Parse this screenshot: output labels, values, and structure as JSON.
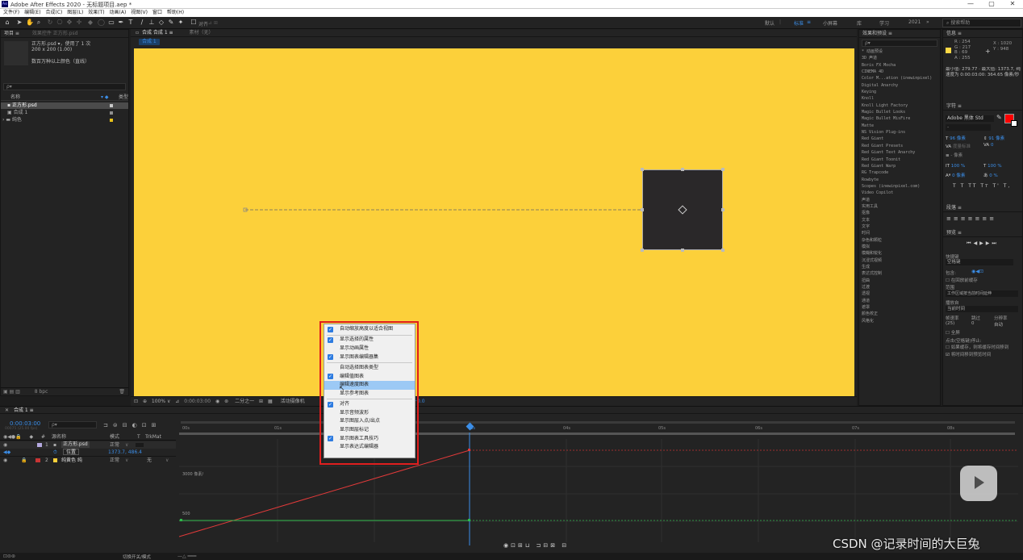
{
  "window": {
    "title": "Adobe After Effects 2020 - 无标题项目.aep *",
    "logo": "Ae",
    "min": "—",
    "max": "▢",
    "close": "✕"
  },
  "menu": [
    "文件(F)",
    "编辑(E)",
    "合成(C)",
    "图层(L)",
    "效果(T)",
    "动画(A)",
    "视图(V)",
    "窗口",
    "帮助(H)"
  ],
  "toolbar": {
    "snap_label": "对齐",
    "workspaces": [
      "默认",
      "标准",
      "小屏幕",
      "库",
      "学习",
      "2021"
    ],
    "active_workspace": "标准",
    "search_placeholder": "搜索帮助"
  },
  "project": {
    "tab": "项目 ≡",
    "effects_tab": "效果控件 正方形.psd",
    "selected_name": "正方形.psd ▾，使用了 1 次",
    "selected_size": "200 x 200 (1.00)",
    "selected_color": "数百万种以上颜色（直线）",
    "search_placeholder": "ρ▾",
    "col_name": "名称",
    "col_type": "类型",
    "items": [
      {
        "name": "正方形.psd",
        "color": "#c8c8c8"
      },
      {
        "name": "合成 1",
        "color": "#8f8f8f"
      },
      {
        "name": "纯色",
        "color": "#e8c21a"
      }
    ]
  },
  "composition": {
    "tab": "合成 合成 1 ≡",
    "footage_tab": "素材（无）",
    "breadcrumb": "合成 1",
    "zoom": "100%",
    "timecode": "0:00:03:00",
    "quality": "二分之一",
    "camera": "活动摄像机",
    "views": "1个…",
    "offset": "+0.0",
    "bit_depth": "8 bpc"
  },
  "context_menu": {
    "items": [
      {
        "label": "自动缩放高度以适合视图",
        "checked": true,
        "sep_after": true,
        "highlight": false
      },
      {
        "label": "显示选择的属性",
        "checked": true,
        "sep_after": false,
        "highlight": false
      },
      {
        "label": "显示动画属性",
        "checked": false,
        "sep_after": false,
        "highlight": false
      },
      {
        "label": "显示图表编辑器集",
        "checked": true,
        "sep_after": true,
        "highlight": false
      },
      {
        "label": "自动选择图表类型",
        "checked": false,
        "sep_after": false,
        "highlight": false
      },
      {
        "label": "编辑值图表",
        "checked": true,
        "sep_after": false,
        "highlight": false
      },
      {
        "label": "编辑速度图表",
        "checked": false,
        "sep_after": false,
        "highlight": true
      },
      {
        "label": "显示参考图表",
        "checked": false,
        "sep_after": true,
        "highlight": false
      },
      {
        "label": "对齐",
        "checked": true,
        "sep_after": false,
        "highlight": false
      },
      {
        "label": "显示音频波形",
        "checked": false,
        "sep_after": false,
        "highlight": false
      },
      {
        "label": "显示图层入点/出点",
        "checked": false,
        "sep_after": false,
        "highlight": false
      },
      {
        "label": "显示图层标记",
        "checked": false,
        "sep_after": false,
        "highlight": false
      },
      {
        "label": "显示图表工具技巧",
        "checked": true,
        "sep_after": false,
        "highlight": false
      },
      {
        "label": "显示表达式编辑器",
        "checked": false,
        "sep_after": false,
        "highlight": false
      }
    ]
  },
  "effects_panel": {
    "tab": "效果和预设 ≡",
    "search": "ρ▾",
    "items": [
      "* 动画预设",
      "3D 声道",
      "Boris FX Mocha",
      "CINEMA 4D",
      "Color M...ation (inewinpixel)",
      "Digital Anarchy",
      "Keying",
      "Knoll",
      "Knoll Light Factory",
      "Magic Bullet Looks",
      "Magic Bullet MisFire",
      "Matte",
      "NS Vision Plug-ins",
      "Red Giant",
      "Red Giant Presets",
      "Red Giant Text Anarchy",
      "Red Giant Toonit",
      "Red Giant Warp",
      "RG Trapcode",
      "Rowbyte",
      "Scopes (inewinpixel.com)",
      "Video Copilot",
      "声道",
      "实用工具",
      "抠像",
      "文本",
      "文字",
      "时间",
      "杂色和颗粒",
      "模拟",
      "模糊和锐化",
      "沉浸式视频",
      "生成",
      "表达式控制",
      "扭曲",
      "过渡",
      "透视",
      "通道",
      "遮罩",
      "颜色校正",
      "风格化"
    ]
  },
  "info_panel": {
    "tab": "信息 ≡",
    "r": "R : 254",
    "g": "G : 217",
    "b": "B : 69",
    "a": "A : 255",
    "x": "X : 1020",
    "y": "Y : 948",
    "line1": "最小值: 279.77 · 最大值: 1373.7, 纯",
    "line2": "速度为 0:00:03:00: 364.65 像素/秒",
    "color": "#fed945"
  },
  "character_panel": {
    "tab": "字符 ≡",
    "font": "Adobe 黑体 Std",
    "style": "-",
    "size": "96 像素",
    "leading": "91 像素",
    "kerning": "度量标准",
    "tracking": "0",
    "stroke": "- 像素",
    "vscale": "100 %",
    "hscale": "100 %",
    "baseline": "0 像素",
    "tsume": "0 %",
    "styles": [
      "T",
      "T",
      "TT",
      "Tт",
      "T'",
      "T,"
    ],
    "fill_color": "#ff0000"
  },
  "paragraph_panel": {
    "tab": "段落 ≡"
  },
  "preview_panel": {
    "tab": "预览 ≡",
    "shortcut_label": "快捷键",
    "shortcut": "空格键",
    "include_label": "包含:",
    "cache_label": "在回放前缓存",
    "range_label": "范围",
    "range": "工作区域按当前时间延伸",
    "play_from_label": "播放自",
    "play_from": "当前时间",
    "fps_label": "帧速率",
    "skip_label": "跳过",
    "res_label": "分辨率",
    "fps": "(25)",
    "skip": "0",
    "res": "自动",
    "fullscreen": "全屏",
    "stop_label": "点击(空格键)停止:",
    "opt1": "如果缓存，则将缓存时间移到",
    "opt2": "将时间移到预览时间"
  },
  "timeline": {
    "tab": "合成 1 ≡",
    "timecode": "0:00:03:00",
    "frame_info": "00075 (25.00 fps)",
    "search": "ρ▾",
    "col_source": "源名称",
    "col_mode": "模式",
    "col_t": "T",
    "col_trkmat": "TrkMat",
    "layers": [
      {
        "num": "1",
        "name": "正方形.psd",
        "mode": "正常",
        "trk": "",
        "color": "#b5a9e0"
      },
      {
        "num": "2",
        "name": "纯黄色 纯",
        "mode": "正常",
        "trk": "无",
        "color": "#c83434"
      }
    ],
    "prop_name": "位置",
    "prop_value": "1373.7, 486.4",
    "ruler": [
      "00s",
      "01s",
      "02s",
      "03s",
      "04s",
      "05s",
      "06s",
      "07s",
      "08s"
    ],
    "graph_label_top": "3000 像素/",
    "graph_label_bottom": "500",
    "status_left": "切换开关/模式"
  },
  "watermark": "CSDN @记录时间的大巨兔"
}
